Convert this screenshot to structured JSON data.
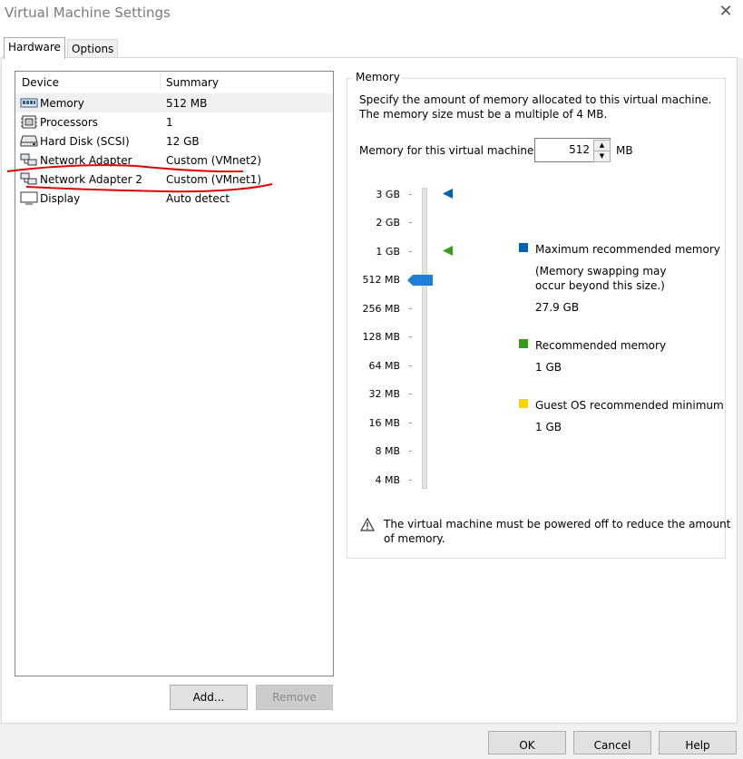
{
  "window": {
    "title": "Virtual Machine Settings"
  },
  "tabs": [
    {
      "label": "Hardware"
    },
    {
      "label": "Options"
    }
  ],
  "device_list": {
    "headers": {
      "device": "Device",
      "summary": "Summary"
    },
    "rows": [
      {
        "name": "Memory",
        "summary": "512 MB",
        "icon": "memory-icon"
      },
      {
        "name": "Processors",
        "summary": "1",
        "icon": "processor-icon"
      },
      {
        "name": "Hard Disk (SCSI)",
        "summary": "12 GB",
        "icon": "hard-disk-icon"
      },
      {
        "name": "Network Adapter",
        "summary": "Custom (VMnet2)",
        "icon": "network-adapter-icon"
      },
      {
        "name": "Network Adapter 2",
        "summary": "Custom (VMnet1)",
        "icon": "network-adapter-icon"
      },
      {
        "name": "Display",
        "summary": "Auto detect",
        "icon": "display-icon"
      }
    ],
    "selected_index": 0
  },
  "buttons": {
    "add": "Add...",
    "remove": "Remove"
  },
  "memory": {
    "group_label": "Memory",
    "description_line1": "Specify the amount of memory allocated to this virtual machine.",
    "description_line2": "The memory size must be a multiple of 4 MB.",
    "field_label": "Memory for this virtual machine:",
    "value": "512",
    "unit": "MB",
    "scale_labels": [
      "3 GB",
      "2 GB",
      "1 GB",
      "512 MB",
      "256 MB",
      "128 MB",
      "64 MB",
      "32 MB",
      "16 MB",
      "8 MB",
      "4 MB"
    ],
    "legend": {
      "max_label": "Maximum recommended memory",
      "max_note_line1": "(Memory swapping may",
      "max_note_line2": "occur beyond this size.)",
      "max_value": "27.9 GB",
      "rec_label": "Recommended memory",
      "rec_value": "1 GB",
      "min_label": "Guest OS recommended minimum",
      "min_value": "1 GB"
    },
    "warning_line1": "The virtual machine must be powered off to reduce the amount",
    "warning_line2": "of memory."
  },
  "footer": {
    "ok": "OK",
    "cancel": "Cancel",
    "help": "Help"
  },
  "colors": {
    "max": "#0063b1",
    "recommended": "#3a9a1a",
    "minimum": "#ffd400",
    "annotation": "#e00000",
    "slider": "#1d7fd6"
  }
}
